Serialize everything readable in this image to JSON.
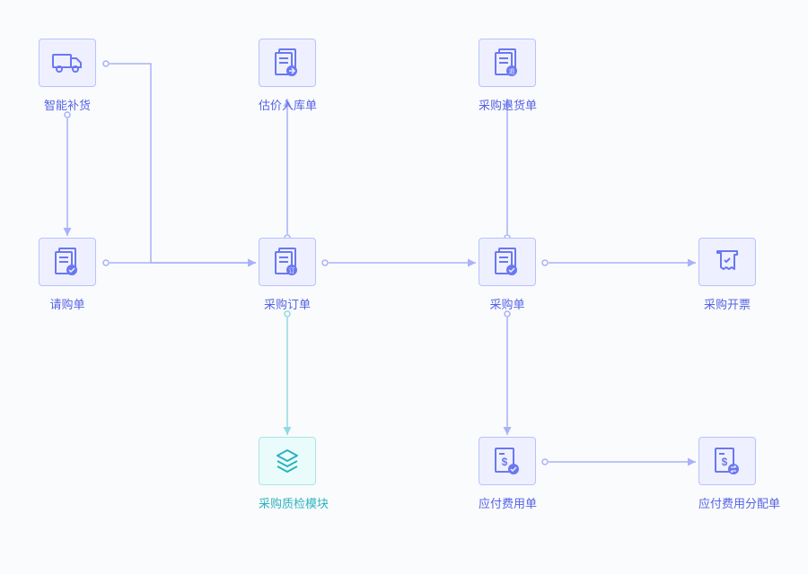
{
  "nodes": {
    "smart_replenish": {
      "label": "智能补货"
    },
    "purchase_request": {
      "label": "请购单"
    },
    "valuation_receipt": {
      "label": "估价入库单"
    },
    "purchase_order": {
      "label": "采购订单"
    },
    "purchase_qc": {
      "label": "采购质检模块"
    },
    "purchase_return": {
      "label": "采购退货单"
    },
    "purchase_doc": {
      "label": "采购单"
    },
    "payable_expense": {
      "label": "应付费用单"
    },
    "purchase_invoice": {
      "label": "采购开票"
    },
    "payable_alloc": {
      "label": "应付费用分配单"
    }
  },
  "colors": {
    "primary": "#6a78f0",
    "arrow": "#a8b2f9",
    "teal": "#2db3c0"
  }
}
